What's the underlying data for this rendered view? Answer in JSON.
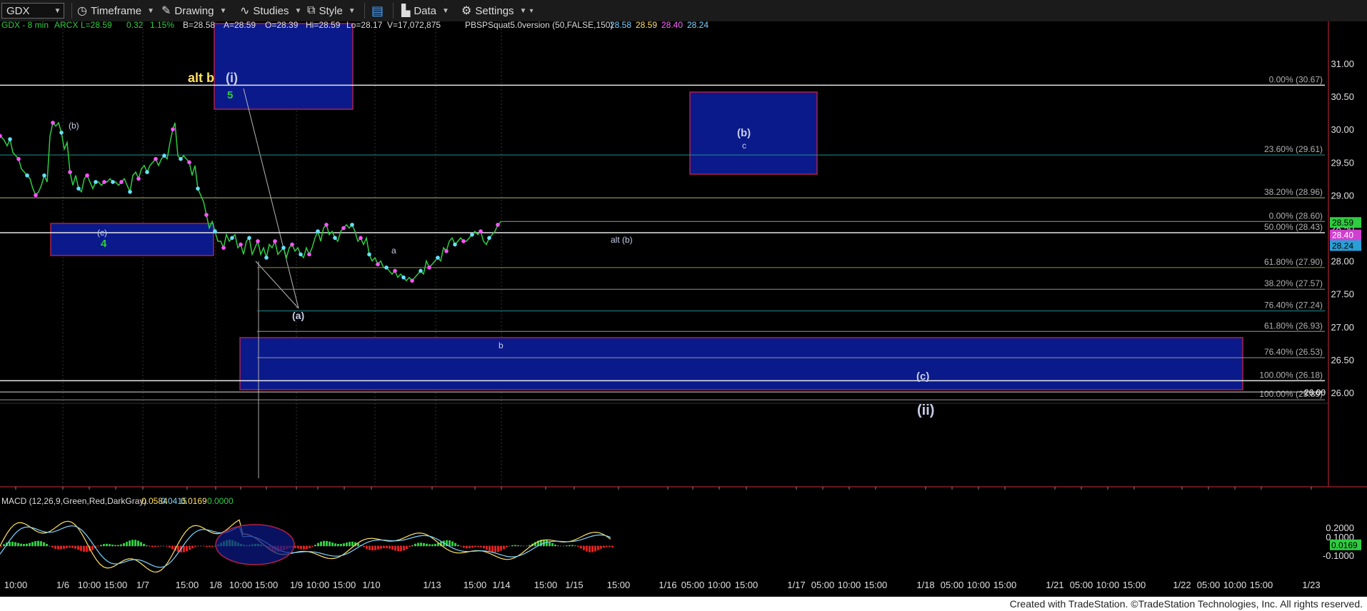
{
  "toolbar": {
    "symbol": "GDX",
    "timeframe_label": "Timeframe",
    "drawing_label": "Drawing",
    "studies_label": "Studies",
    "style_label": "Style",
    "data_label": "Data",
    "settings_label": "Settings"
  },
  "header_line": {
    "symbol": "GDX - 8 min",
    "exchange": "ARCX",
    "last": "L=28.59",
    "change": "0.32",
    "change_pct": "1.15%",
    "bid": "B=28.58",
    "ask": "A=28.59",
    "open": "O=28.39",
    "high": "Hi=28.59",
    "low": "Lo=28.17",
    "volume": "V=17,072,875",
    "study": "PBSPSquat5.0version (50,FALSE,150)",
    "study_values": [
      "28.58",
      "28.59",
      "28.40",
      "28.24"
    ],
    "study_colors": [
      "#7fd4ff",
      "#ffe066",
      "#ff66ff",
      "#7fd4ff"
    ]
  },
  "macd": {
    "label": "MACD (12,26,9,Green,Red,DarkGray)",
    "values": [
      "0.0584",
      "0.0415",
      "0.0169",
      "0.0000"
    ],
    "value_colors": [
      "#ffe066",
      "#7fd4ff",
      "#ffe066",
      "#2ecc40"
    ],
    "axis_ticks": [
      "0.2000",
      "0.1000",
      "-0.1000"
    ],
    "current": "0.0169"
  },
  "footer": "Created with TradeStation. ©TradeStation Technologies, Inc. All rights reserved.",
  "colors": {
    "background": "#000000",
    "price_line": "#2ecc40",
    "box_fill": "#0b1a8a",
    "box_border": "#b0204a",
    "label": "#c7cde8",
    "yellow": "#ffe066"
  },
  "chart_data": {
    "type": "line",
    "y_ticks": [
      "31.00",
      "30.50",
      "30.00",
      "29.50",
      "29.00",
      "28.50",
      "28.00",
      "27.50",
      "27.00",
      "26.50",
      "26.00"
    ],
    "x_labels": [
      "10:00",
      "1/6",
      "10:00",
      "15:00",
      "1/7",
      "15:00",
      "1/8",
      "10:00",
      "15:00",
      "1/9",
      "10:00",
      "15:00",
      "1/10",
      "1/13",
      "15:00",
      "1/14",
      "15:00",
      "1/15",
      "15:00",
      "1/16",
      "05:00",
      "10:00",
      "15:00",
      "1/17",
      "05:00",
      "10:00",
      "15:00",
      "1/18",
      "05:00",
      "10:00",
      "15:00",
      "1/21",
      "05:00",
      "10:00",
      "15:00",
      "1/22",
      "05:00",
      "10:00",
      "15:00",
      "1/23"
    ],
    "price_series": [
      [
        0,
        29.9
      ],
      [
        5,
        29.85
      ],
      [
        10,
        29.75
      ],
      [
        14,
        29.85
      ],
      [
        18,
        29.65
      ],
      [
        22,
        29.6
      ],
      [
        26,
        29.55
      ],
      [
        30,
        29.4
      ],
      [
        34,
        29.35
      ],
      [
        38,
        29.3
      ],
      [
        42,
        29.25
      ],
      [
        46,
        29.1
      ],
      [
        50,
        29.0
      ],
      [
        54,
        29.05
      ],
      [
        58,
        29.15
      ],
      [
        62,
        29.3
      ],
      [
        66,
        29.2
      ],
      [
        70,
        29.9
      ],
      [
        74,
        30.1
      ],
      [
        78,
        30.05
      ],
      [
        82,
        30.1
      ],
      [
        86,
        29.95
      ],
      [
        90,
        29.7
      ],
      [
        94,
        29.8
      ],
      [
        98,
        29.35
      ],
      [
        102,
        29.15
      ],
      [
        106,
        29.3
      ],
      [
        110,
        29.1
      ],
      [
        114,
        29.05
      ],
      [
        118,
        29.25
      ],
      [
        122,
        29.3
      ],
      [
        126,
        29.2
      ],
      [
        130,
        29.1
      ],
      [
        134,
        29.2
      ],
      [
        138,
        29.2
      ],
      [
        142,
        29.15
      ],
      [
        146,
        29.2
      ],
      [
        150,
        29.2
      ],
      [
        154,
        29.25
      ],
      [
        158,
        29.2
      ],
      [
        162,
        29.2
      ],
      [
        166,
        29.15
      ],
      [
        170,
        29.2
      ],
      [
        174,
        29.25
      ],
      [
        178,
        29.15
      ],
      [
        182,
        29.05
      ],
      [
        186,
        29.3
      ],
      [
        190,
        29.35
      ],
      [
        194,
        29.25
      ],
      [
        198,
        29.4
      ],
      [
        202,
        29.45
      ],
      [
        206,
        29.35
      ],
      [
        210,
        29.45
      ],
      [
        214,
        29.5
      ],
      [
        218,
        29.55
      ],
      [
        222,
        29.45
      ],
      [
        226,
        29.55
      ],
      [
        230,
        29.6
      ],
      [
        234,
        29.55
      ],
      [
        238,
        29.8
      ],
      [
        242,
        30.0
      ],
      [
        245,
        30.1
      ],
      [
        249,
        29.6
      ],
      [
        253,
        29.55
      ],
      [
        257,
        29.6
      ],
      [
        261,
        29.55
      ],
      [
        265,
        29.5
      ],
      [
        269,
        29.3
      ],
      [
        273,
        29.45
      ],
      [
        277,
        29.1
      ],
      [
        281,
        29.0
      ],
      [
        285,
        28.9
      ],
      [
        289,
        28.7
      ],
      [
        293,
        28.5
      ],
      [
        297,
        28.6
      ],
      [
        301,
        28.45
      ],
      [
        305,
        28.3
      ],
      [
        309,
        28.3
      ],
      [
        313,
        28.2
      ],
      [
        317,
        28.4
      ],
      [
        321,
        28.3
      ],
      [
        325,
        28.35
      ],
      [
        329,
        28.4
      ],
      [
        333,
        28.2
      ],
      [
        337,
        28.25
      ],
      [
        341,
        28.1
      ],
      [
        345,
        28.3
      ],
      [
        349,
        28.35
      ],
      [
        353,
        28.1
      ],
      [
        357,
        28.2
      ],
      [
        361,
        28.3
      ],
      [
        365,
        28.1
      ],
      [
        369,
        28.2
      ],
      [
        373,
        28.05
      ],
      [
        377,
        28.25
      ],
      [
        381,
        28.2
      ],
      [
        385,
        28.3
      ],
      [
        389,
        28.1
      ],
      [
        393,
        28.15
      ],
      [
        397,
        28.2
      ],
      [
        401,
        28.05
      ],
      [
        405,
        28.2
      ],
      [
        409,
        28.25
      ],
      [
        413,
        28.15
      ],
      [
        417,
        28.2
      ],
      [
        421,
        28.1
      ],
      [
        425,
        28.05
      ],
      [
        429,
        28.2
      ],
      [
        433,
        28.1
      ],
      [
        437,
        28.2
      ],
      [
        441,
        28.35
      ],
      [
        445,
        28.45
      ],
      [
        449,
        28.3
      ],
      [
        453,
        28.5
      ],
      [
        457,
        28.55
      ],
      [
        461,
        28.4
      ],
      [
        465,
        28.45
      ],
      [
        469,
        28.35
      ],
      [
        473,
        28.3
      ],
      [
        477,
        28.45
      ],
      [
        481,
        28.5
      ],
      [
        485,
        28.55
      ],
      [
        489,
        28.5
      ],
      [
        493,
        28.55
      ],
      [
        497,
        28.45
      ],
      [
        501,
        28.3
      ],
      [
        505,
        28.35
      ],
      [
        509,
        28.25
      ],
      [
        513,
        28.35
      ],
      [
        517,
        28.1
      ],
      [
        521,
        28.0
      ],
      [
        525,
        28.05
      ],
      [
        529,
        27.95
      ],
      [
        533,
        28.0
      ],
      [
        537,
        27.9
      ],
      [
        541,
        27.9
      ],
      [
        545,
        27.85
      ],
      [
        549,
        27.8
      ],
      [
        553,
        27.85
      ],
      [
        557,
        27.75
      ],
      [
        561,
        27.8
      ],
      [
        565,
        27.75
      ],
      [
        569,
        27.7
      ],
      [
        573,
        27.75
      ],
      [
        577,
        27.7
      ],
      [
        581,
        27.75
      ],
      [
        585,
        27.8
      ],
      [
        589,
        27.85
      ],
      [
        593,
        27.8
      ],
      [
        597,
        28.0
      ],
      [
        601,
        27.9
      ],
      [
        605,
        27.95
      ],
      [
        609,
        28.0
      ],
      [
        613,
        28.05
      ],
      [
        617,
        28.0
      ],
      [
        621,
        28.2
      ],
      [
        625,
        28.15
      ],
      [
        629,
        28.3
      ],
      [
        633,
        28.35
      ],
      [
        637,
        28.25
      ],
      [
        641,
        28.3
      ],
      [
        645,
        28.35
      ],
      [
        649,
        28.3
      ],
      [
        653,
        28.3
      ],
      [
        657,
        28.35
      ],
      [
        661,
        28.4
      ],
      [
        665,
        28.45
      ],
      [
        669,
        28.4
      ],
      [
        673,
        28.45
      ],
      [
        677,
        28.3
      ],
      [
        681,
        28.25
      ],
      [
        685,
        28.35
      ],
      [
        689,
        28.4
      ],
      [
        693,
        28.45
      ],
      [
        697,
        28.55
      ],
      [
        701,
        28.59
      ]
    ],
    "fib_lines": [
      {
        "label": "0.00% (30.67)",
        "value": 30.67,
        "color": "#e6e6e6"
      },
      {
        "label": "23.60% (29.61)",
        "value": 29.61,
        "color": "#1f8f8f"
      },
      {
        "label": "38.20% (28.96)",
        "value": 28.96,
        "color": "#b8b860"
      },
      {
        "label": "0.00% (28.60)",
        "value": 28.6,
        "color": "#999999"
      },
      {
        "label": "50.00% (28.43)",
        "value": 28.43,
        "color": "#e6e6e6"
      },
      {
        "label": "61.80% (27.90)",
        "value": 27.9,
        "color": "#8f8f3a"
      },
      {
        "label": "38.20% (27.57)",
        "value": 27.57,
        "color": "#8f8f8f"
      },
      {
        "label": "76.40% (27.24)",
        "value": 27.24,
        "color": "#1f8f8f"
      },
      {
        "label": "61.80% (26.93)",
        "value": 26.93,
        "color": "#999999"
      },
      {
        "label": "76.40% (26.53)",
        "value": 26.53,
        "color": "#999999"
      },
      {
        "label": "100.00% (26.18)",
        "value": 26.18,
        "color": "#e6e6e6"
      },
      {
        "label": "100.00% (25.89)",
        "value": 25.89,
        "color": "#999999"
      }
    ],
    "level_26": "26.00",
    "price_badges": [
      {
        "text": "28.59",
        "value": 28.59,
        "bg": "#2ecc40",
        "fg": "#000"
      },
      {
        "text": "28.40",
        "value": 28.4,
        "bg": "#d040d0",
        "fg": "#fff"
      },
      {
        "text": "28.24",
        "value": 28.24,
        "bg": "#2a9fd6",
        "fg": "#000"
      }
    ],
    "annotations": [
      "alt b",
      "(i)",
      "5",
      "(b)",
      "(c)",
      "4",
      "a",
      "(a)",
      "b",
      "alt (b)",
      "(b)",
      "c",
      "(c)",
      "(ii)"
    ]
  }
}
